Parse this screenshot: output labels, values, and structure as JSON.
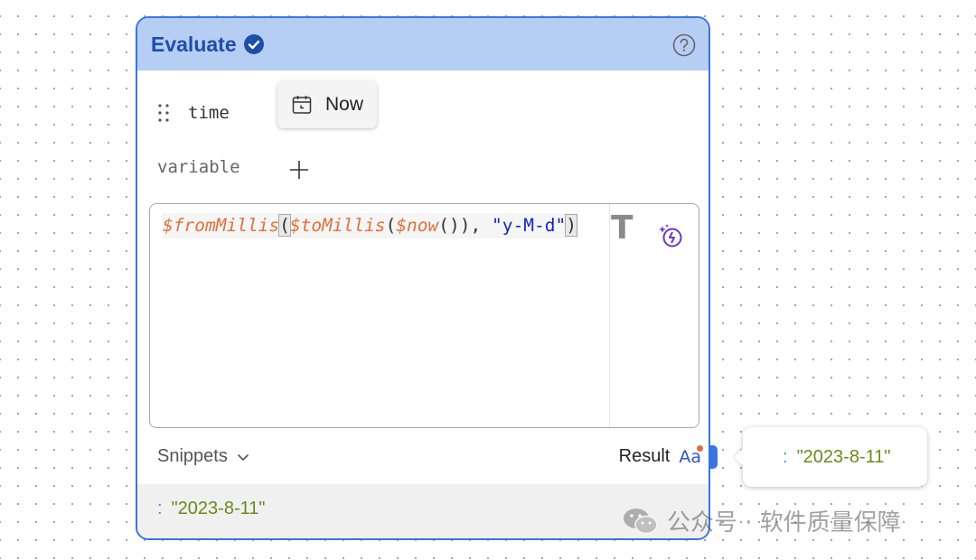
{
  "node": {
    "title": "Evaluate",
    "accent_color": "#3b74e0",
    "header_color": "#b6cdf4",
    "header_icons": [
      "check-circle-icon",
      "help-circle-icon"
    ]
  },
  "time_row": {
    "label": "time",
    "button_label": "Now",
    "button_icon": "calendar-icon"
  },
  "variable_row": {
    "label": "variable",
    "add_icon": "plus-icon"
  },
  "editor": {
    "tokens": {
      "fn1": "$fromMillis",
      "p1": "(",
      "fn2": "$toMillis",
      "p2": "(",
      "fn3": "$now",
      "p3": "()),",
      "str": "\"y-M-d\"",
      "p4": ")"
    },
    "cursor_glyph": "T",
    "assist_icon": "magic-wand-icon"
  },
  "footer_bar": {
    "snippets_label": "Snippets",
    "result_label": "Result",
    "format_toggle": "Aa"
  },
  "result_preview": {
    "colon": ":",
    "value": "\"2023-8-11\""
  },
  "result_popup": {
    "colon": ":",
    "value": "\"2023-8-11\""
  },
  "watermark": {
    "text": "公众号 · 软件质量保障"
  }
}
